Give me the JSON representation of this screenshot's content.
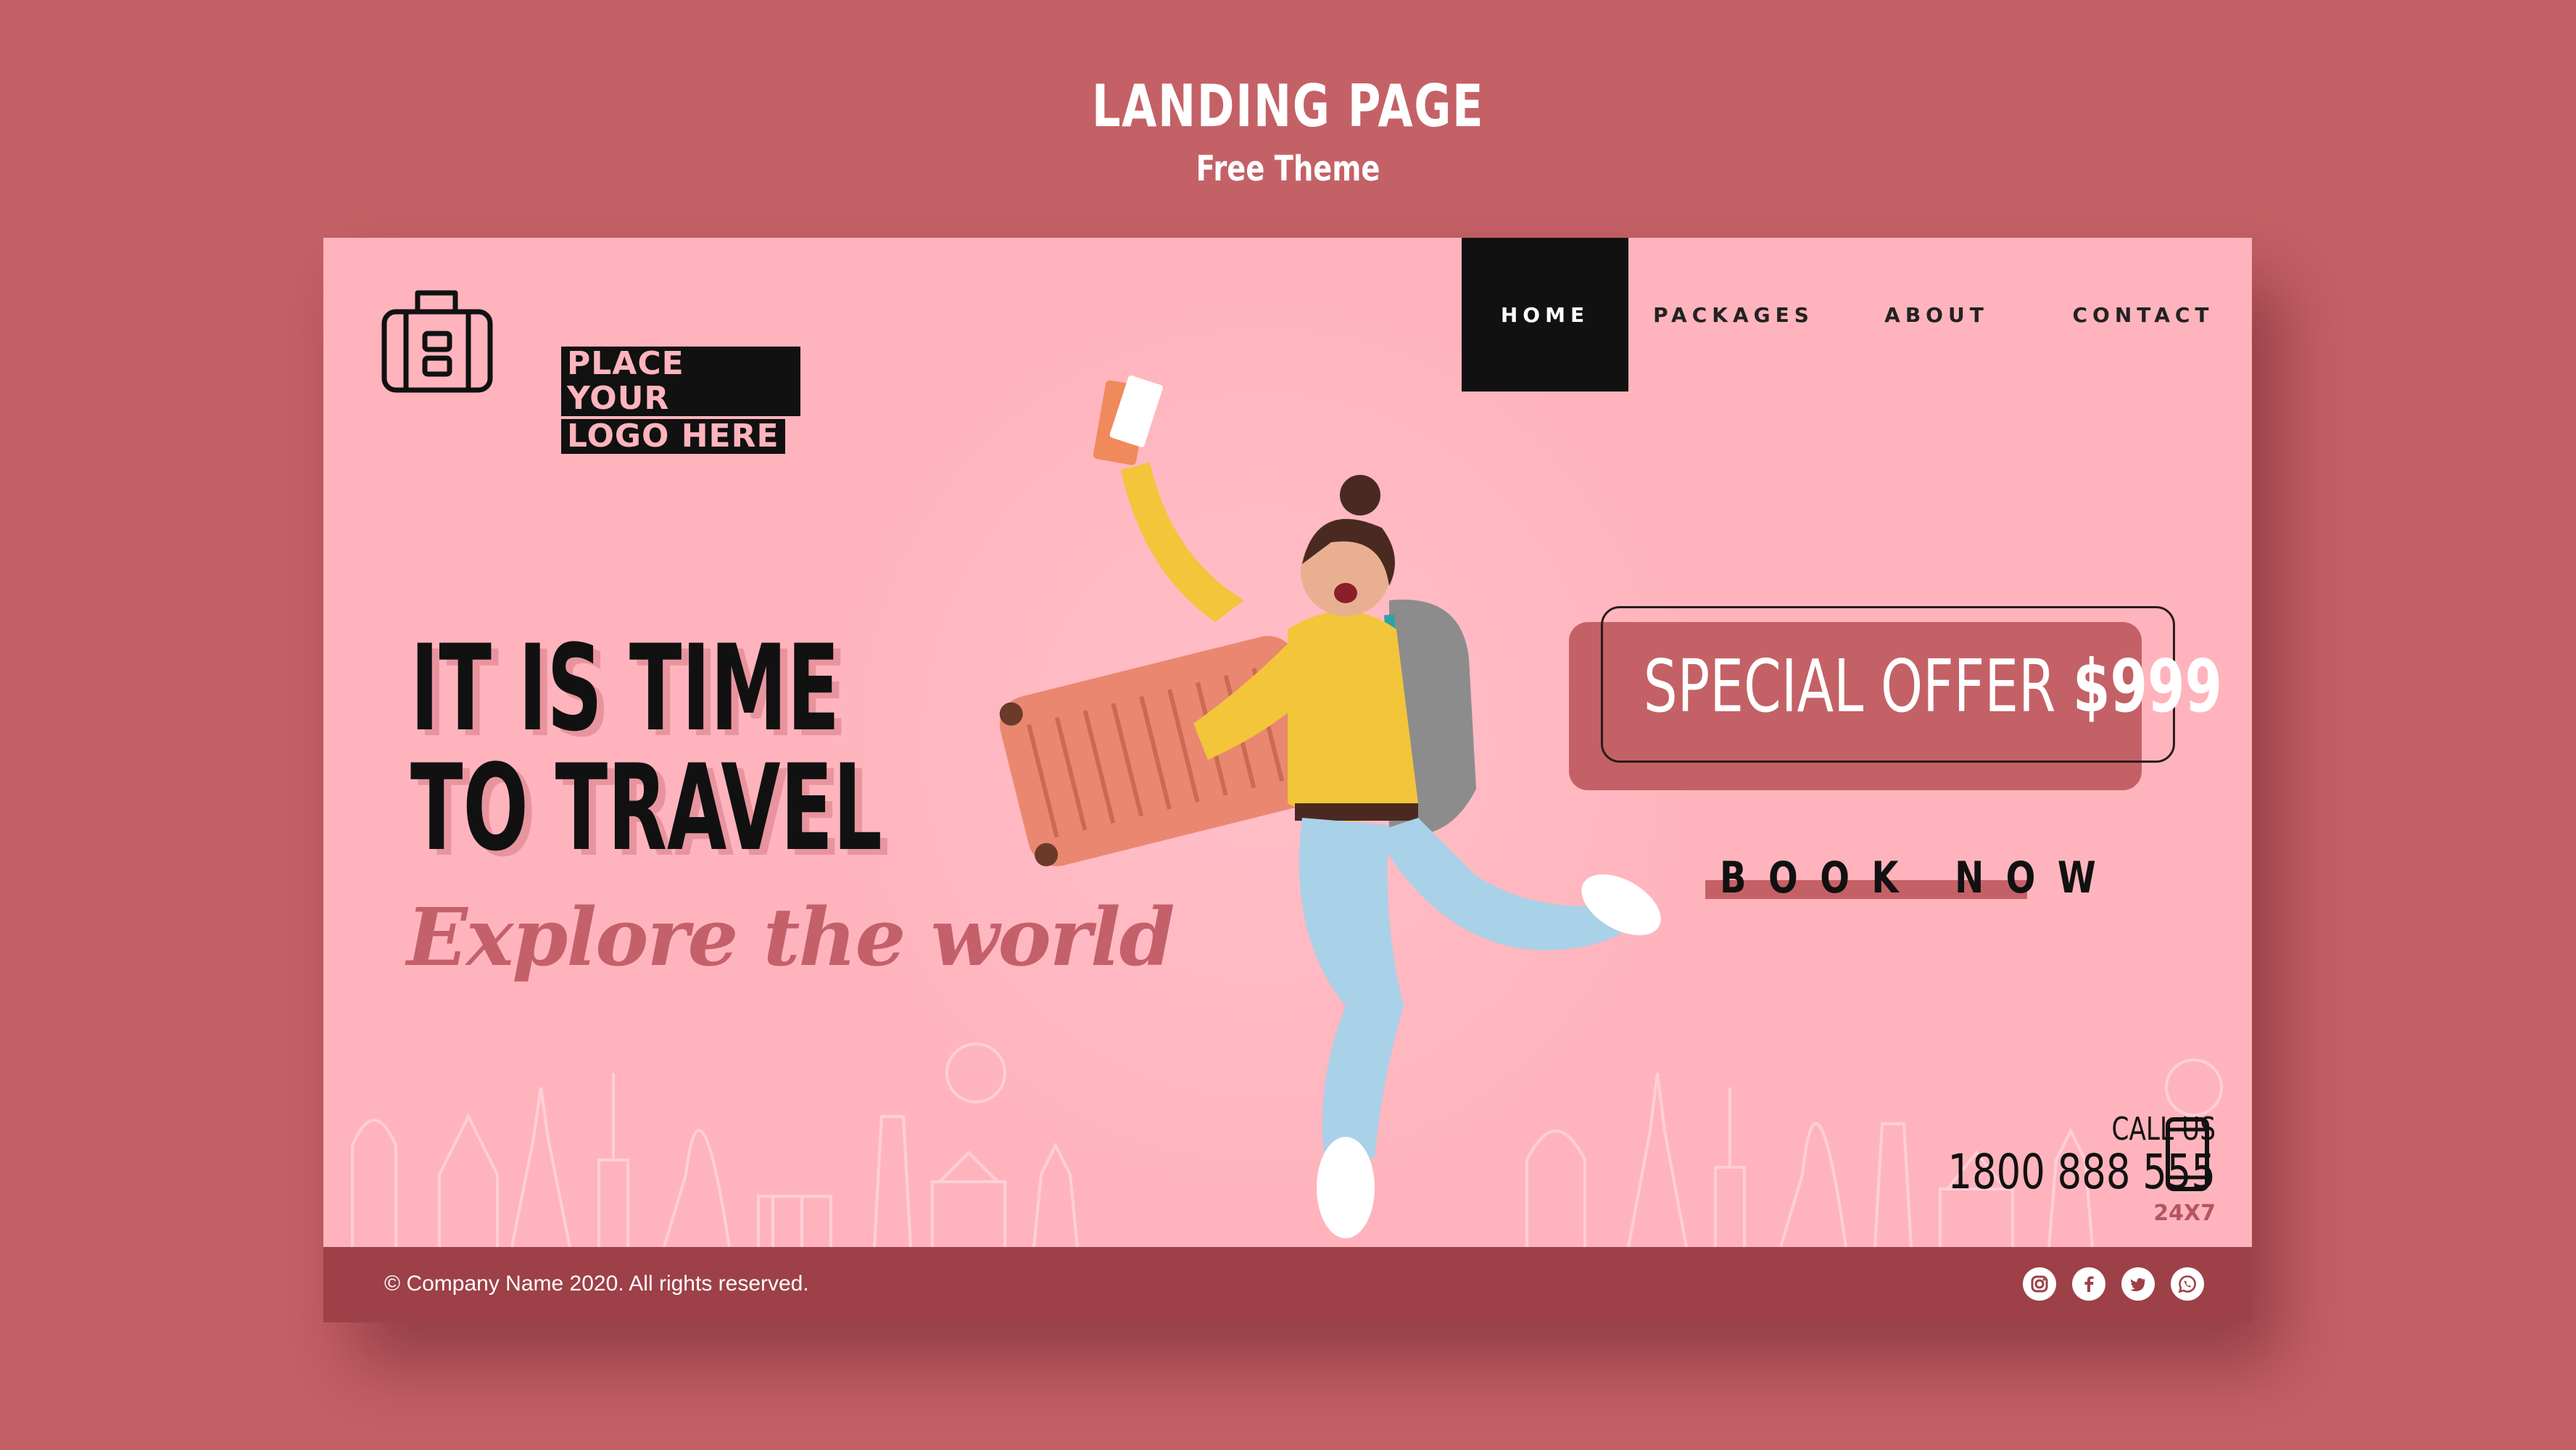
{
  "header": {
    "title": "LANDING PAGE",
    "subtitle": "Free Theme"
  },
  "logo": {
    "line1": "PLACE YOUR",
    "line2": "LOGO HERE"
  },
  "nav": {
    "items": [
      {
        "label": "HOME",
        "active": true
      },
      {
        "label": "PACKAGES",
        "active": false
      },
      {
        "label": "ABOUT",
        "active": false
      },
      {
        "label": "CONTACT",
        "active": false
      }
    ]
  },
  "hero": {
    "line1": "IT IS TIME",
    "line2": "TO TRAVEL",
    "tagline": "Explore the world"
  },
  "offer": {
    "label": "SPECIAL OFFER",
    "price": "$999"
  },
  "cta": {
    "label": "BOOK NOW"
  },
  "contact": {
    "label": "CALL US",
    "phone": "1800 888 555",
    "hours": "24X7"
  },
  "footer": {
    "copyright": "© Company Name 2020. All rights reserved.",
    "socials": [
      "instagram-icon",
      "facebook-icon",
      "twitter-icon",
      "whatsapp-icon"
    ]
  },
  "colors": {
    "background": "#c46166",
    "card": "#ffb4bd",
    "accent": "#c46166",
    "footer": "#9d4048",
    "dark": "#111111"
  }
}
